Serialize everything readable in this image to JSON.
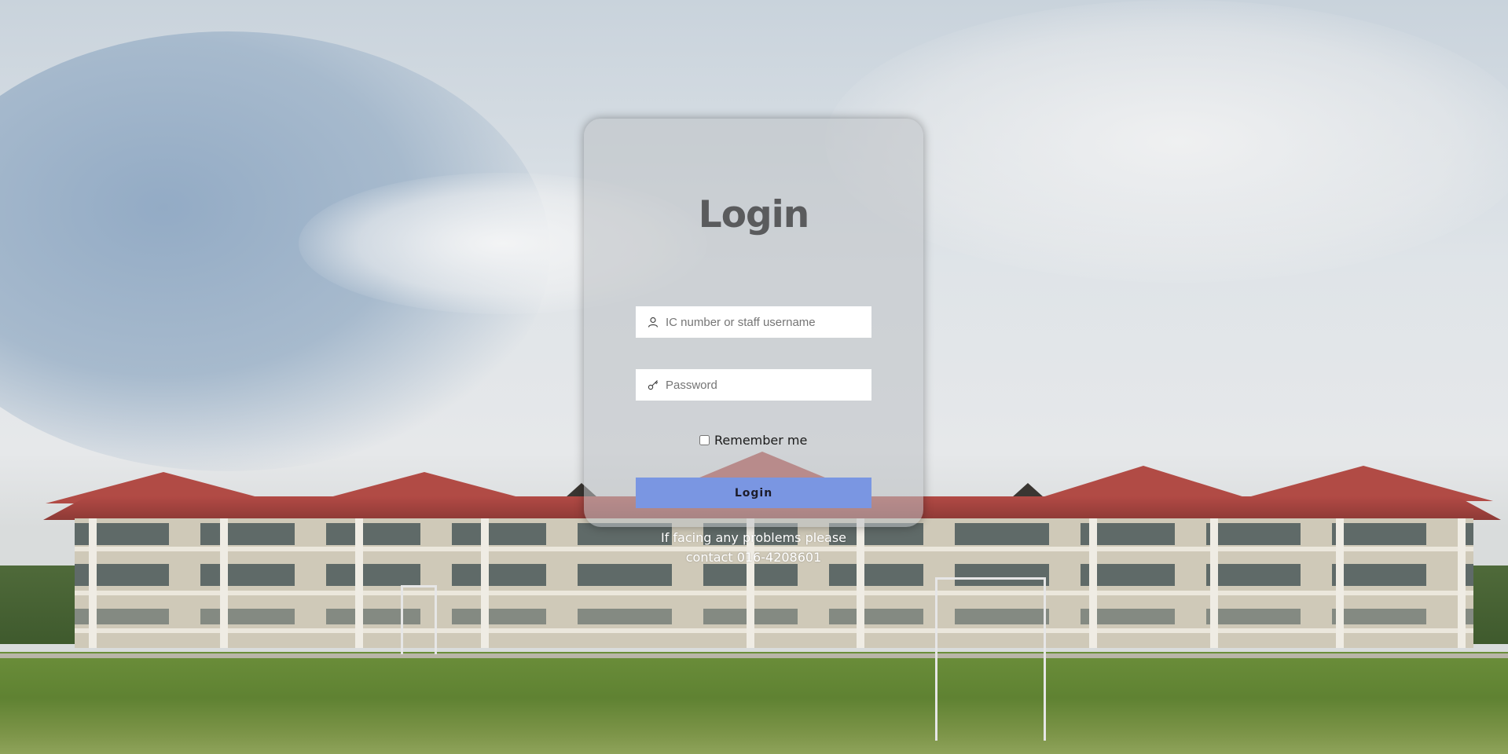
{
  "login": {
    "title": "Login",
    "username": {
      "placeholder": "IC number or staff username",
      "value": ""
    },
    "password": {
      "placeholder": "Password",
      "value": ""
    },
    "remember_label": "Remember me",
    "remember_checked": false,
    "submit_label": "Login",
    "help_line1": "If facing any problems please",
    "help_line2": "contact 016-4208601"
  },
  "icons": {
    "username": "user-icon",
    "password": "key-icon"
  },
  "colors": {
    "button": "#7a96e2",
    "title": "#5a5b5d"
  }
}
